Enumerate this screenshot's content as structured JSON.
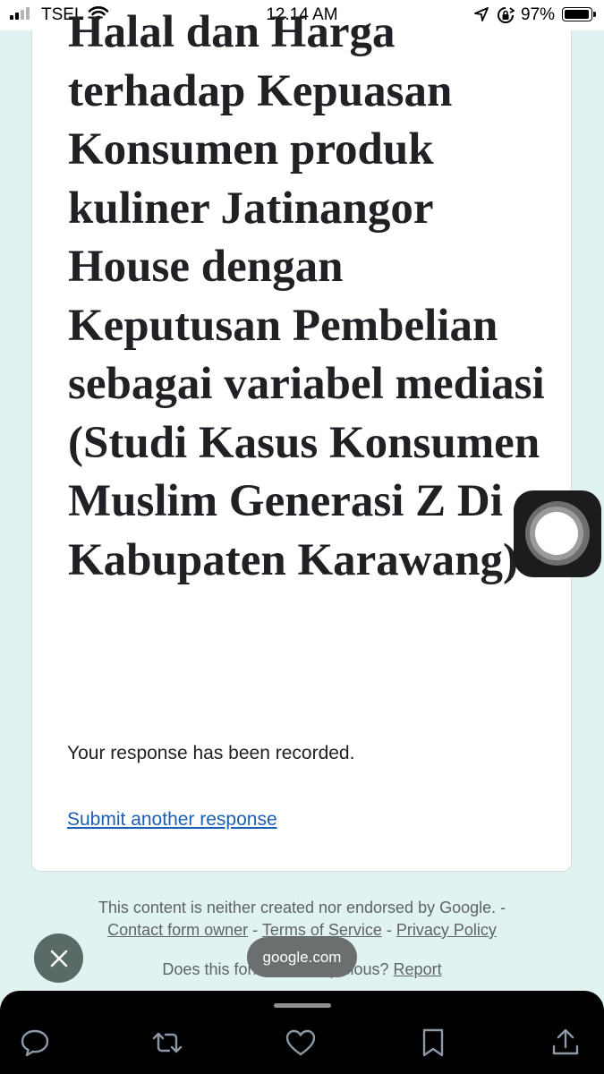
{
  "status_bar": {
    "carrier": "TSEL",
    "time": "12.14 AM",
    "battery_percent": "97%",
    "signal_bars": 4,
    "signal_bars_active": 2,
    "battery_level": 0.97
  },
  "form": {
    "title": "Halal dan Harga terhadap Kepuasan Konsumen produk kuliner Jatinangor House dengan Keputusan Pembelian sebagai variabel mediasi (Studi Kasus Konsumen Muslim Generasi Z Di Kabupaten Karawang)",
    "confirmation": "Your response has been recorded.",
    "submit_another": "Submit another response"
  },
  "footer": {
    "disclaimer": "This content is neither created nor endorsed by Google. -",
    "contact_owner": "Contact form owner",
    "separator": " - ",
    "terms": "Terms of Service",
    "privacy": "Privacy Policy",
    "suspicious_prefix": "Does this form look suspicious?",
    "report": "Report"
  },
  "overlay": {
    "domain": "google.com"
  },
  "toolbar": {
    "icons": [
      "reply-icon",
      "retweet-icon",
      "like-icon",
      "bookmark-icon",
      "share-icon"
    ]
  },
  "colors": {
    "page_background": "#e0f3f1",
    "link": "#1a5fb4",
    "title_text": "#202124",
    "toolbar": "#000000"
  }
}
